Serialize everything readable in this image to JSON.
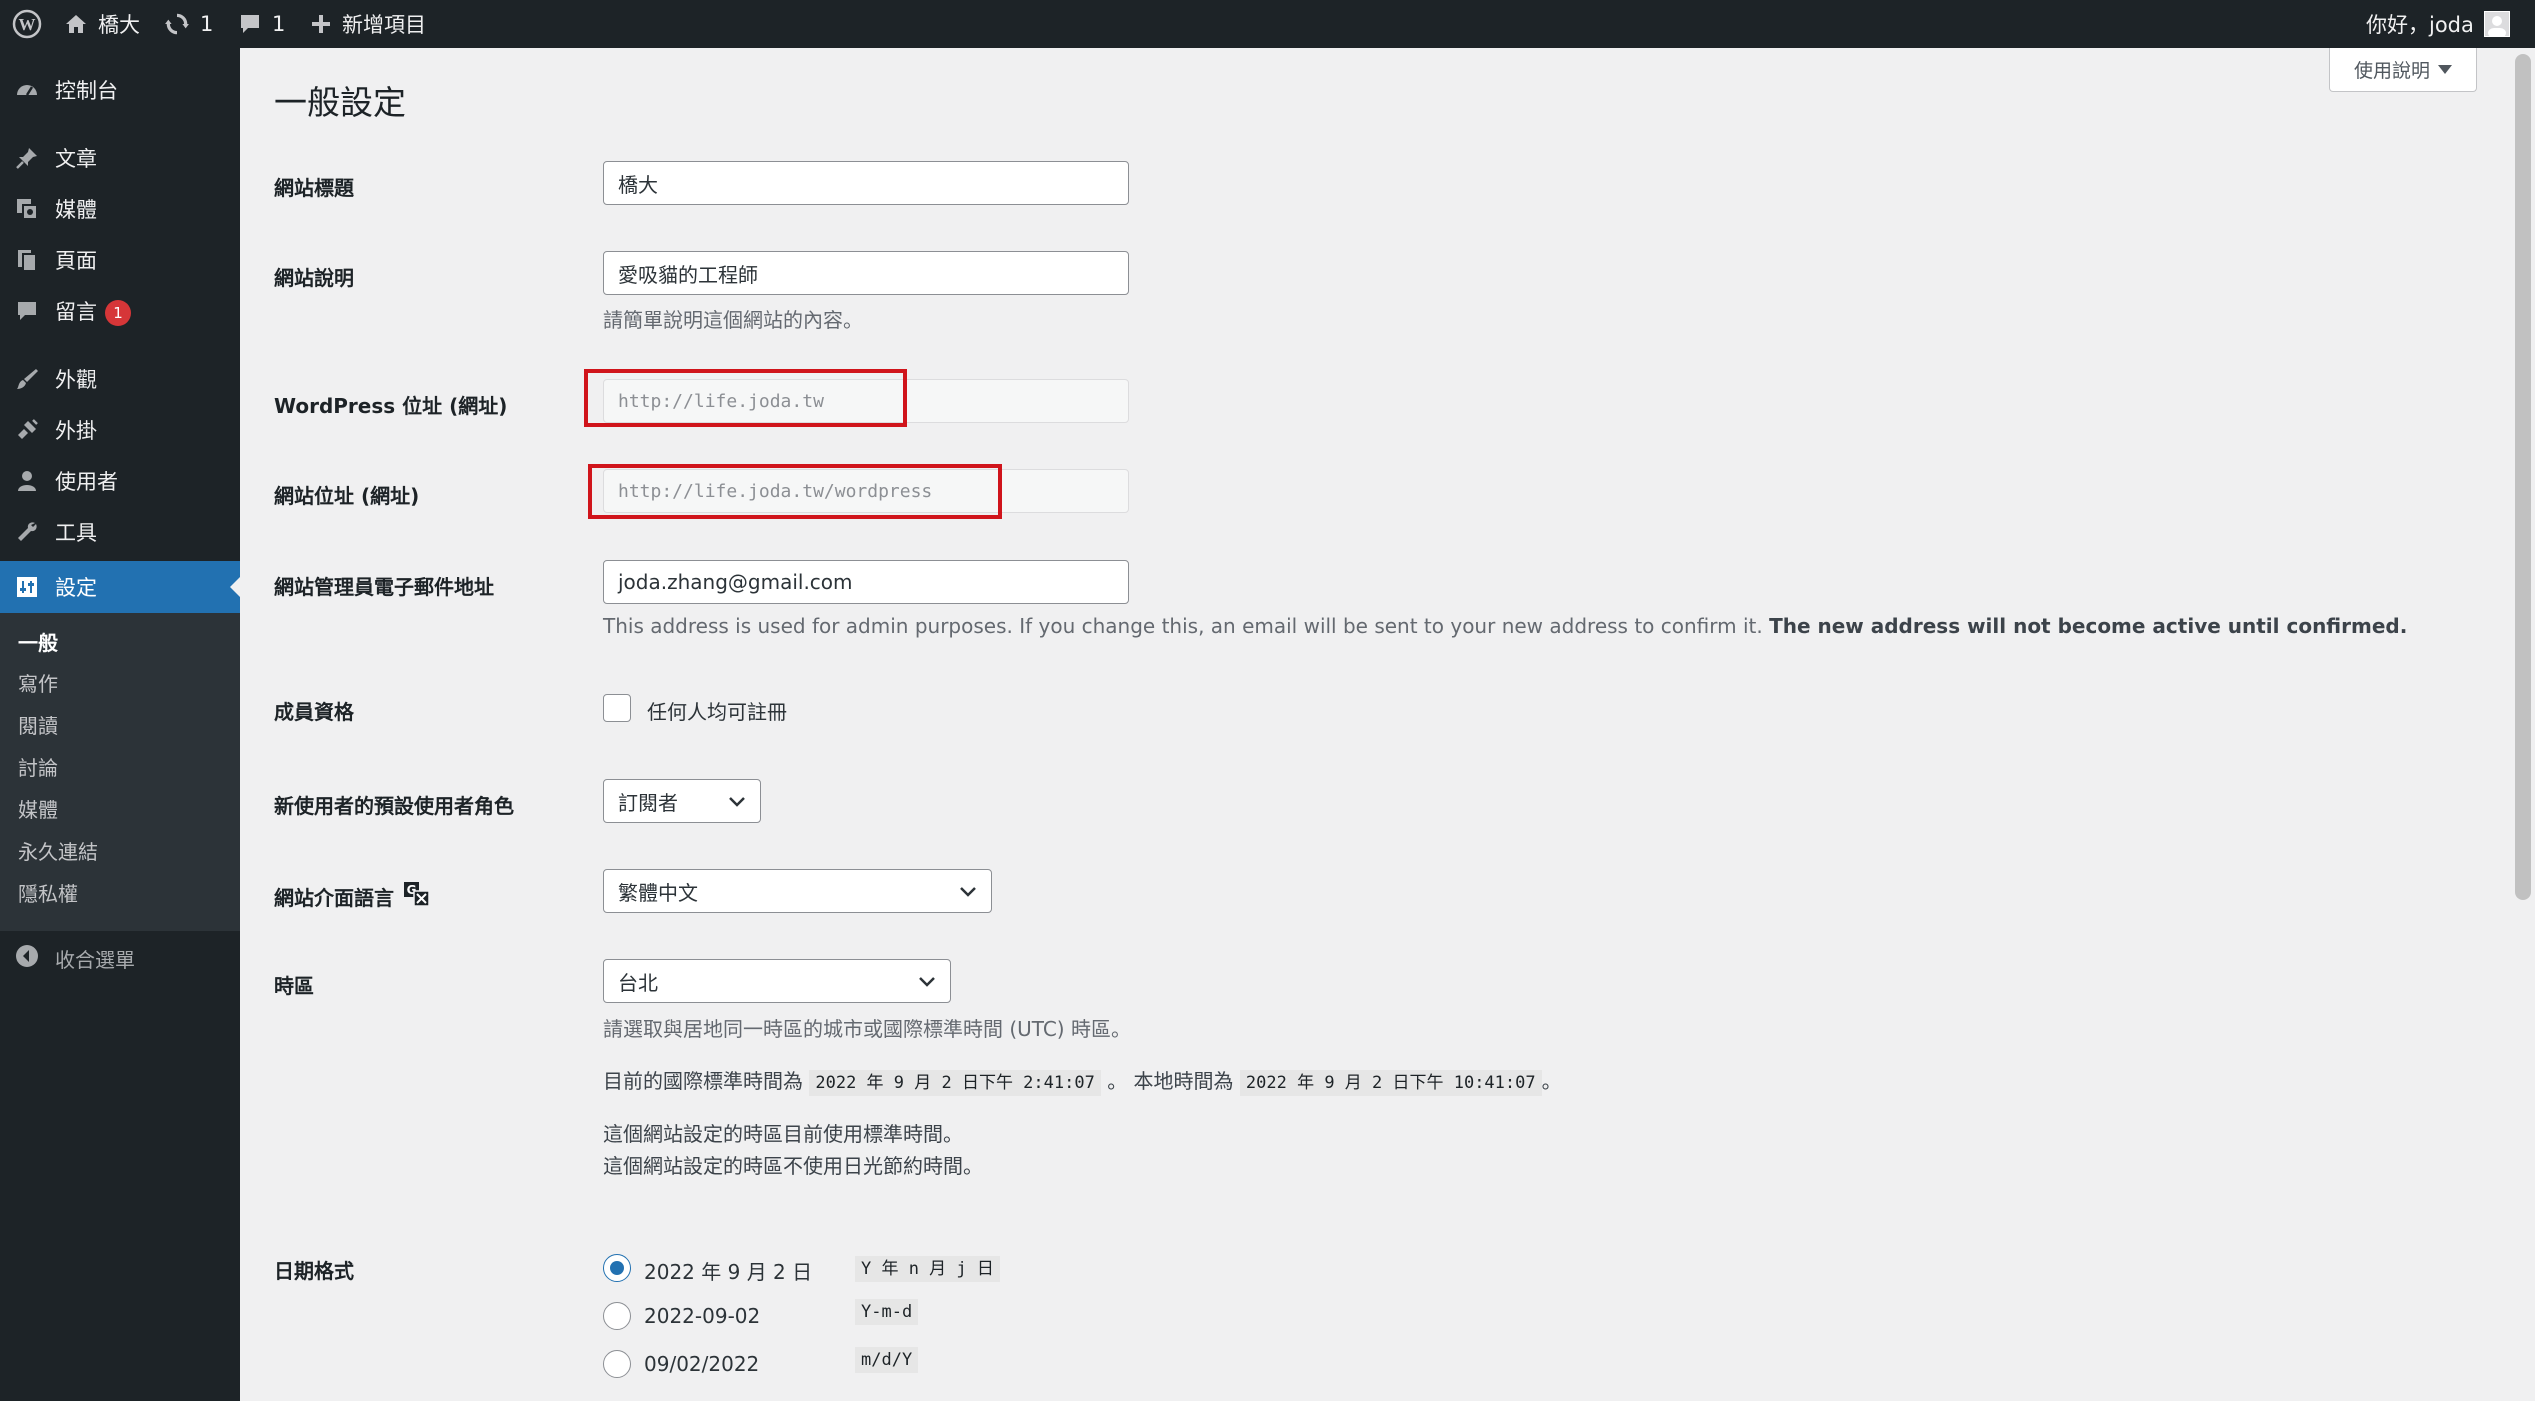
{
  "admin_bar": {
    "site_name": "橋大",
    "updates_count": "1",
    "comments_count": "1",
    "new_item_label": "新增項目",
    "greeting": "你好，joda"
  },
  "sidebar": {
    "items": [
      {
        "label": "控制台",
        "icon": "dashboard-icon"
      },
      {
        "label": "文章",
        "icon": "pin-icon"
      },
      {
        "label": "媒體",
        "icon": "media-icon"
      },
      {
        "label": "頁面",
        "icon": "page-icon"
      },
      {
        "label": "留言",
        "icon": "comment-icon",
        "badge": "1"
      },
      {
        "label": "外觀",
        "icon": "brush-icon"
      },
      {
        "label": "外掛",
        "icon": "plugin-icon"
      },
      {
        "label": "使用者",
        "icon": "user-icon"
      },
      {
        "label": "工具",
        "icon": "wrench-icon"
      },
      {
        "label": "設定",
        "icon": "settings-icon"
      }
    ],
    "submenu": [
      "一般",
      "寫作",
      "閱讀",
      "討論",
      "媒體",
      "永久連結",
      "隱私權"
    ],
    "collapse_label": "收合選單"
  },
  "help_tab": "使用說明",
  "page_title": "一般設定",
  "fields": {
    "site_title": {
      "label": "網站標題",
      "value": "橋大"
    },
    "tagline": {
      "label": "網站說明",
      "value": "愛吸貓的工程師",
      "description": "請簡單說明這個網站的內容。"
    },
    "wp_address": {
      "label": "WordPress 位址 (網址)",
      "value": "http://life.joda.tw"
    },
    "site_address": {
      "label": "網站位址 (網址)",
      "value": "http://life.joda.tw/wordpress"
    },
    "admin_email": {
      "label": "網站管理員電子郵件地址",
      "value": "joda.zhang@gmail.com",
      "description": "This address is used for admin purposes. If you change this, an email will be sent to your new address to confirm it.",
      "description_bold": "The new address will not become active until confirmed."
    },
    "membership": {
      "label": "成員資格",
      "checkbox_label": "任何人均可註冊"
    },
    "default_role": {
      "label": "新使用者的預設使用者角色",
      "value": "訂閱者"
    },
    "site_language": {
      "label": "網站介面語言",
      "value": "繁體中文"
    },
    "timezone": {
      "label": "時區",
      "value": "台北",
      "description": "請選取與居地同一時區的城市或國際標準時間 (UTC) 時區。",
      "utc_prefix": "目前的國際標準時間為",
      "utc_time": "2022 年 9 月 2 日下午 2:41:07",
      "local_prefix": "。 本地時間為",
      "local_time": "2022 年 9 月 2 日下午 10:41:07",
      "local_suffix": "。",
      "note_1": "這個網站設定的時區目前使用標準時間。",
      "note_2": "這個網站設定的時區不使用日光節約時間。"
    },
    "date_format": {
      "label": "日期格式",
      "options": [
        {
          "label": "2022 年 9 月 2 日",
          "code": "Y 年 n 月 j 日",
          "checked": true
        },
        {
          "label": "2022-09-02",
          "code": "Y-m-d",
          "checked": false
        },
        {
          "label": "09/02/2022",
          "code": "m/d/Y",
          "checked": false
        }
      ]
    }
  }
}
